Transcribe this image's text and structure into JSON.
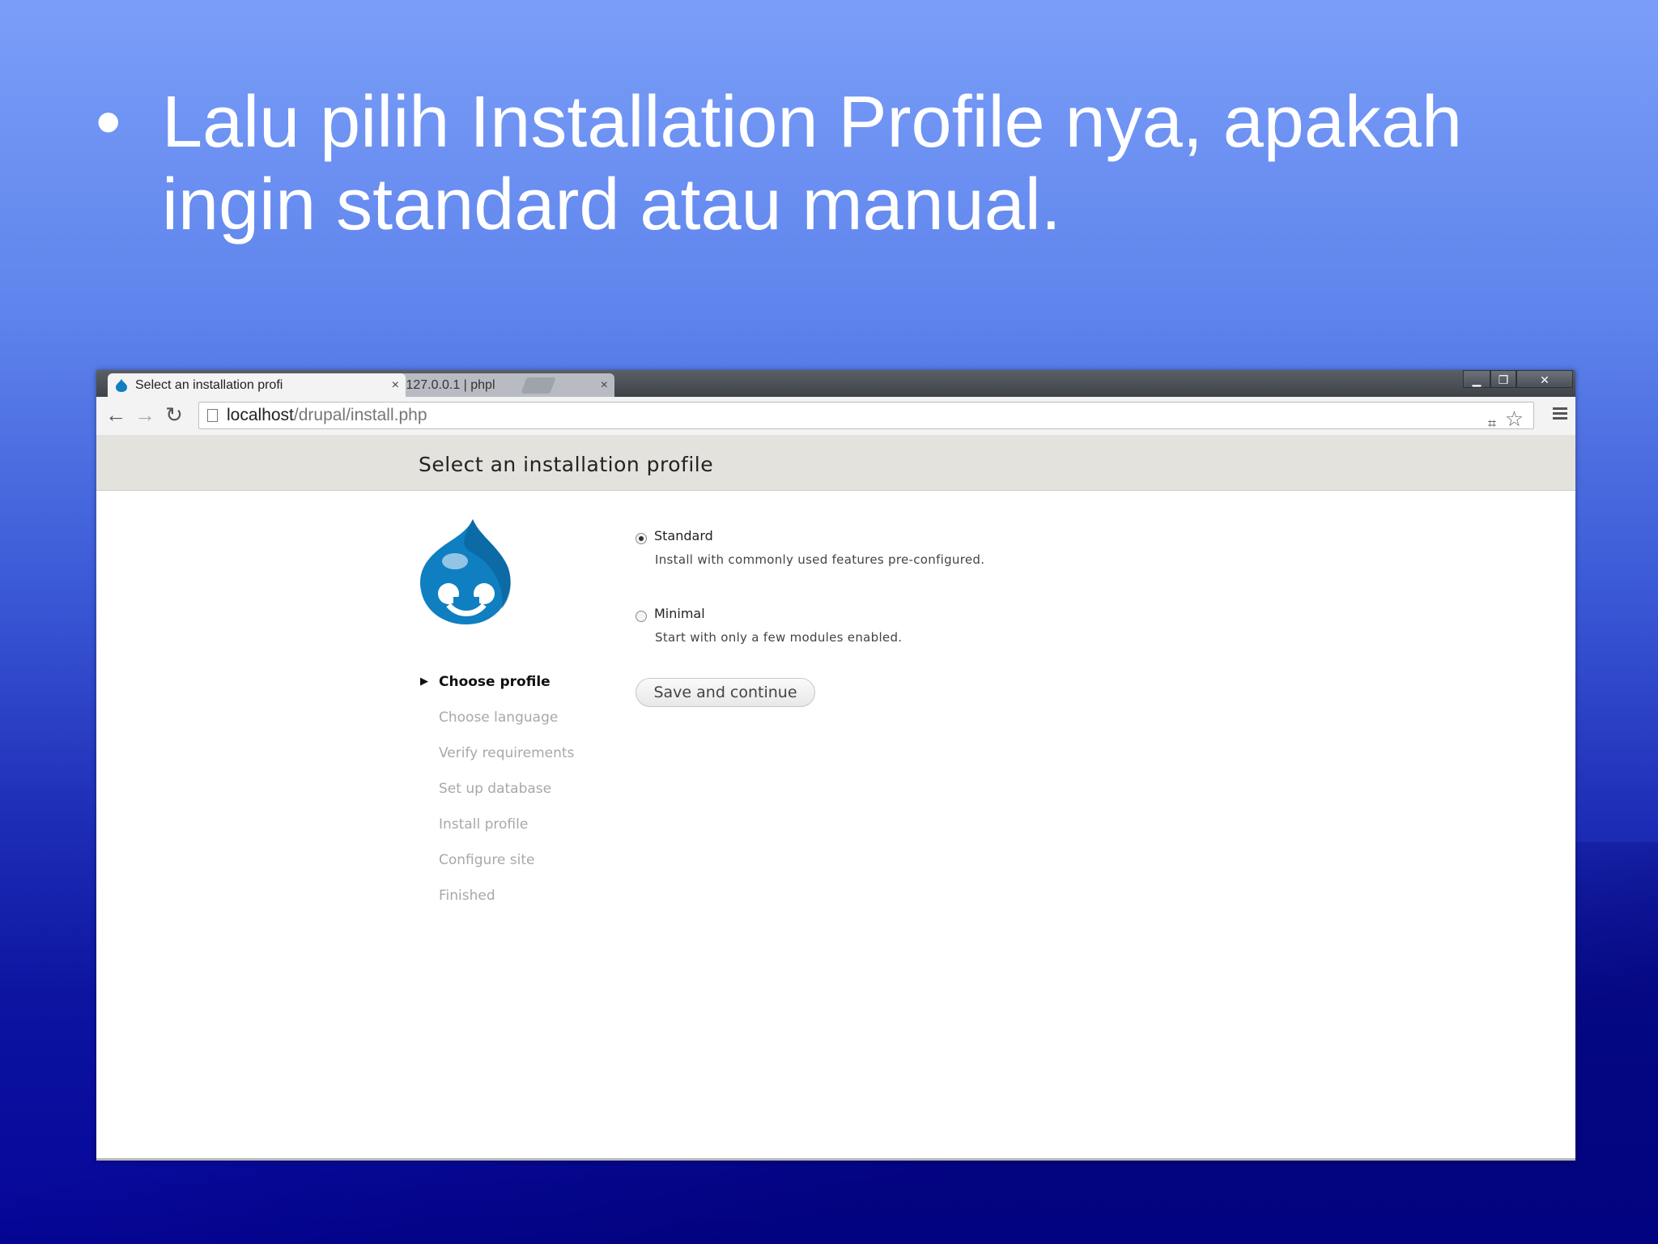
{
  "slide": {
    "bullet_symbol": "•",
    "bullet_text": "Lalu pilih Installation Profile nya, apakah ingin standard atau manual."
  },
  "browser": {
    "tabs": [
      {
        "label": "Select an installation profi",
        "icon": "drupal-favicon-icon"
      },
      {
        "label": "localhost / 127.0.0.1 | phpl",
        "icon": "phpmyadmin-favicon-icon"
      }
    ],
    "tab_close_glyph": "×",
    "window_controls": {
      "minimize": "▁",
      "restore": "❐",
      "close": "✕"
    },
    "nav": {
      "back": "←",
      "forward": "→",
      "reload": "↻"
    },
    "url": {
      "host": "localhost",
      "path": "/drupal/install.php"
    },
    "omni_icons": {
      "translate": "⌗",
      "star": "☆"
    }
  },
  "installer": {
    "title": "Select an installation profile",
    "steps": [
      {
        "label": "Choose profile",
        "current": true
      },
      {
        "label": "Choose language",
        "current": false
      },
      {
        "label": "Verify requirements",
        "current": false
      },
      {
        "label": "Set up database",
        "current": false
      },
      {
        "label": "Install profile",
        "current": false
      },
      {
        "label": "Configure site",
        "current": false
      },
      {
        "label": "Finished",
        "current": false
      }
    ],
    "current_step_arrow": "▶",
    "profiles": [
      {
        "label": "Standard",
        "description": "Install with commonly used features pre-configured.",
        "selected": true
      },
      {
        "label": "Minimal",
        "description": "Start with only a few modules enabled.",
        "selected": false
      }
    ],
    "submit_label": "Save and continue"
  },
  "colors": {
    "drupal_blue": "#0f7fc2",
    "header_bg": "#e4e2dc"
  }
}
